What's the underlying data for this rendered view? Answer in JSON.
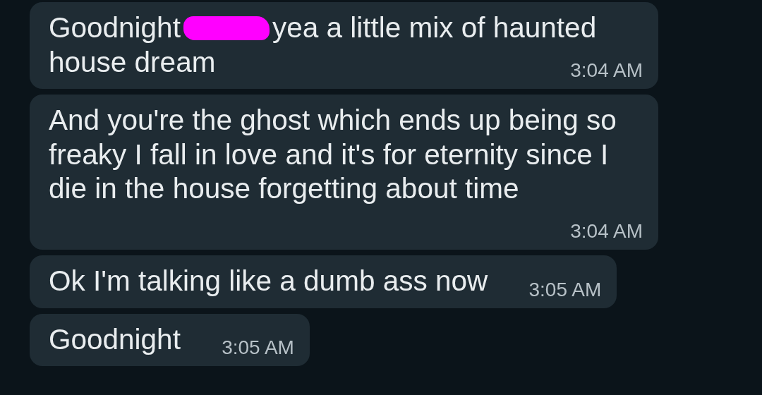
{
  "messages": [
    {
      "kind": "redacted",
      "text_before": "Goodnight",
      "text_after": "yea a little mix of haunted",
      "text_next_line": "house dream",
      "time": "3:04 AM"
    },
    {
      "kind": "plain",
      "text": "And you're the ghost which ends up being so freaky I fall in love and it's for eternity since I die in the house forgetting about time",
      "time": "3:04 AM"
    },
    {
      "kind": "plain",
      "text": "Ok I'm talking like a dumb ass now",
      "time": "3:05 AM"
    },
    {
      "kind": "plain",
      "text": "Goodnight",
      "time": "3:05 AM"
    }
  ]
}
